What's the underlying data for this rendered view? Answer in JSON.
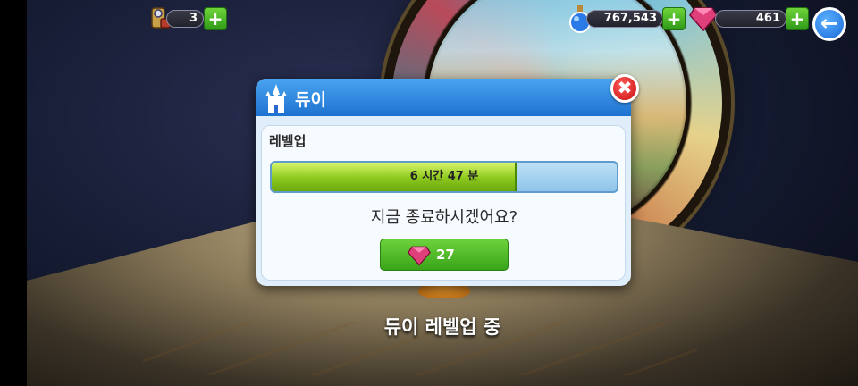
{
  "hud": {
    "keys_count": "3",
    "magic_count": "767,543",
    "gems_count": "461"
  },
  "dialog": {
    "title": "듀이",
    "section_label": "레벨업",
    "progress_text": "6 시간 47 분",
    "progress_fraction": 0.71,
    "question": "지금 종료하시겠어요?",
    "confirm_cost": "27"
  },
  "status_text": "듀이 레벨업 중",
  "icons": {
    "keys": "key-bundle-icon",
    "magic": "magic-potion-icon",
    "gems": "gem-icon",
    "back": "back-arrow-icon",
    "close": "close-icon",
    "castle": "castle-icon"
  },
  "colors": {
    "accent_green": "#3aa41a",
    "header_blue": "#1e72d0",
    "close_red": "#c81010",
    "gem_pink": "#e0407a"
  }
}
